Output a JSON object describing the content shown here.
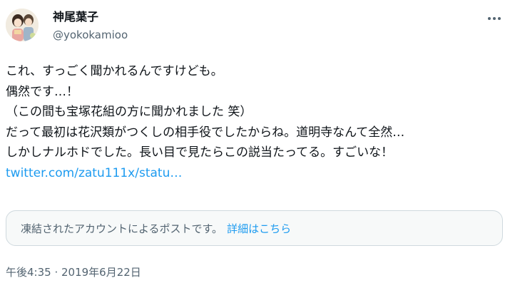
{
  "author": {
    "display_name": "神尾葉子",
    "handle": "@yokokamioo"
  },
  "tweet": {
    "lines": [
      "これ、すっごく聞かれるんですけども。",
      "偶然です…！",
      "（この間も宝塚花組の方に聞かれました 笑）",
      "だって最初は花沢類がつくしの相手役でしたからね。道明寺なんて全然…",
      "しかしナルホドでした。長い目で見たらこの説当たってる。すごいな！"
    ],
    "link_text": "twitter.com/zatu111x/statu…"
  },
  "notice": {
    "text": "凍結されたアカウントによるポストです。",
    "link_label": "詳細はこちら"
  },
  "timestamp": "午後4:35 · 2019年6月22日",
  "icons": {
    "more": "more-horizontal-icon",
    "avatar": "illustrated-avatar"
  },
  "colors": {
    "link": "#1d9bf0",
    "text": "#0f1419",
    "secondary": "#536471",
    "notice_bg": "#f7f9f9",
    "border": "#cfd9de"
  }
}
